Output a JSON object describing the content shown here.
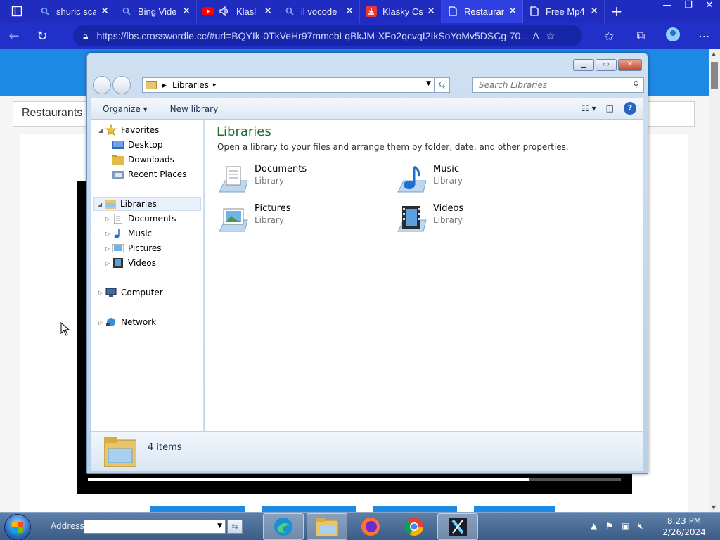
{
  "browser": {
    "tabs": [
      {
        "label": "shuric sca",
        "icon": "search-icon"
      },
      {
        "label": "Bing Vide",
        "icon": "search-icon"
      },
      {
        "label": "Klasl",
        "icon": "youtube-icon"
      },
      {
        "label": "il vocode",
        "icon": "search-icon"
      },
      {
        "label": "Klasky Cs",
        "icon": "download-icon"
      },
      {
        "label": "Restaurar",
        "icon": "page-icon",
        "active": true
      },
      {
        "label": "Free Mp4",
        "icon": "page-icon"
      }
    ],
    "url": "https://lbs.crosswordle.cc/#url=BQYIk-0TkVeHr97mmcbLqBkJM-XFo2qcvqI2IkSoYoMv5DSCg-70..."
  },
  "page": {
    "search_text": "Restaurants"
  },
  "explorer": {
    "breadcrumb": "Libraries",
    "search_placeholder": "Search Libraries",
    "toolbar": {
      "organize": "Organize",
      "new_library": "New library"
    },
    "nav": {
      "favorites": "Favorites",
      "favorites_items": [
        "Desktop",
        "Downloads",
        "Recent Places"
      ],
      "libraries": "Libraries",
      "library_items": [
        "Documents",
        "Music",
        "Pictures",
        "Videos"
      ],
      "computer": "Computer",
      "network": "Network"
    },
    "content": {
      "title": "Libraries",
      "subtitle": "Open a library to your files and arrange them by folder, date, and other properties.",
      "libraries": [
        {
          "name": "Documents",
          "type": "Library"
        },
        {
          "name": "Music",
          "type": "Library"
        },
        {
          "name": "Pictures",
          "type": "Library"
        },
        {
          "name": "Videos",
          "type": "Library"
        }
      ]
    },
    "details": {
      "count": "4 items"
    }
  },
  "taskbar": {
    "address_label": "Address",
    "time": "8:23 PM",
    "date": "2/26/2024"
  },
  "colors": {
    "browser_bar": "#1f2cbf",
    "active_tab": "#2f3fe0",
    "library_title": "#1e6b2a",
    "page_blue": "#1e88e5"
  }
}
